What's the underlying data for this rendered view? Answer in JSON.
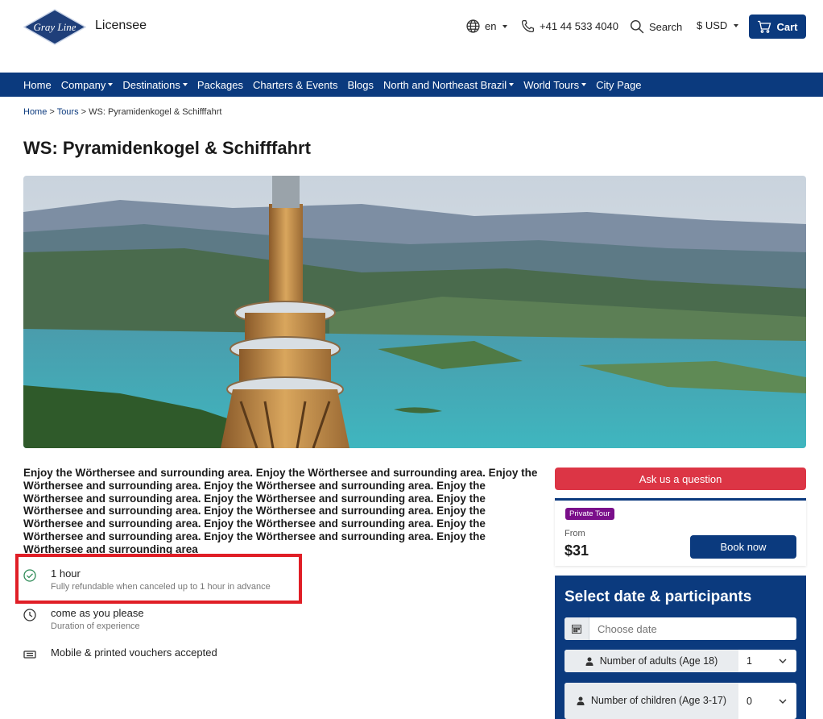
{
  "header": {
    "logo_text": "Gray Line",
    "licensee": "Licensee",
    "language": "en",
    "phone": "+41 44 533 4040",
    "search": "Search",
    "currency": "$ USD",
    "cart": "Cart"
  },
  "nav": {
    "items": [
      {
        "label": "Home"
      },
      {
        "label": "Company"
      },
      {
        "label": "Destinations"
      },
      {
        "label": "Packages"
      },
      {
        "label": "Charters & Events"
      },
      {
        "label": "Blogs"
      },
      {
        "label": "North and Northeast Brazil"
      },
      {
        "label": "World Tours"
      },
      {
        "label": "City Page"
      }
    ]
  },
  "breadcrumb": {
    "home": "Home",
    "sep1": " > ",
    "tours": "Tours",
    "sep2": " > ",
    "current": "WS: Pyramidenkogel & Schifffahrt"
  },
  "page": {
    "title": "WS: Pyramidenkogel & Schifffahrt",
    "description": "Enjoy the Wörthersee and surrounding area. Enjoy the Wörthersee and surrounding area. Enjoy the Wörthersee and surrounding area. Enjoy the Wörthersee and surrounding area. Enjoy the Wörthersee and surrounding area. Enjoy the Wörthersee and surrounding area. Enjoy the Wörthersee and surrounding area. Enjoy the Wörthersee and surrounding area. Enjoy the Wörthersee and surrounding area. Enjoy the Wörthersee and surrounding area. Enjoy the Wörthersee and surrounding area. Enjoy the Wörthersee and surrounding area. Enjoy the Wörthersee and surrounding area"
  },
  "features": {
    "refund_main": "1 hour",
    "refund_sub": "Fully refundable when canceled up to 1 hour in advance",
    "duration_main": "come as you please",
    "duration_sub": "Duration of experience",
    "voucher_main": "Mobile & printed vouchers accepted"
  },
  "booking": {
    "ask": "Ask us a question",
    "badge": "Private Tour",
    "from": "From",
    "price": "$31",
    "book": "Book now",
    "select_title": "Select date & participants",
    "date_placeholder": "Choose date",
    "adults_label": "Number of adults (Age 18)",
    "adults_value": "1",
    "children_label": "Number of children (Age 3-17)",
    "children_value": "0"
  },
  "colors": {
    "brand": "#0b3a7e",
    "danger": "#dc3545",
    "badge": "#7a0f8a",
    "highlight": "#e01e26"
  }
}
